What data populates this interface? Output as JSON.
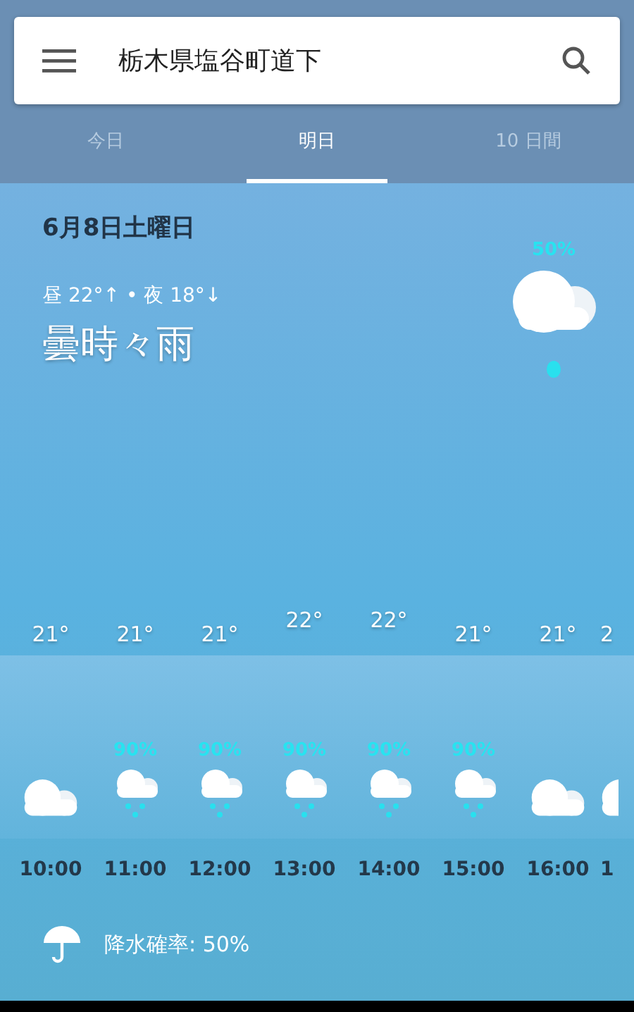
{
  "search": {
    "menu": true,
    "value": "栃木県塩谷町道下"
  },
  "tabs": [
    {
      "label": "今日",
      "selected": false
    },
    {
      "label": "明日",
      "selected": true
    },
    {
      "label": "10 日間",
      "selected": false
    }
  ],
  "summary": {
    "date": "6月8日土曜日",
    "temps": "昼 22°↑ • 夜 18°↓",
    "condition": "曇時々雨",
    "precip": "50%",
    "kind": "rain"
  },
  "hours": [
    {
      "temp": "21°",
      "kind": "cloudy",
      "time": "10:00"
    },
    {
      "temp": "21°",
      "kind": "rain",
      "precip": "90%",
      "time": "11:00"
    },
    {
      "temp": "21°",
      "kind": "rain",
      "precip": "90%",
      "time": "12:00"
    },
    {
      "temp": "22°",
      "kind": "rain",
      "precip": "90%",
      "time": "13:00"
    },
    {
      "temp": "22°",
      "kind": "rain",
      "precip": "90%",
      "time": "14:00"
    },
    {
      "temp": "21°",
      "kind": "rain",
      "precip": "90%",
      "time": "15:00"
    },
    {
      "temp": "21°",
      "kind": "cloudy",
      "time": "16:00"
    },
    {
      "temp": "2",
      "kind": "cloudy",
      "time": "1"
    }
  ],
  "footer": {
    "text": "降水確率: 50%"
  }
}
